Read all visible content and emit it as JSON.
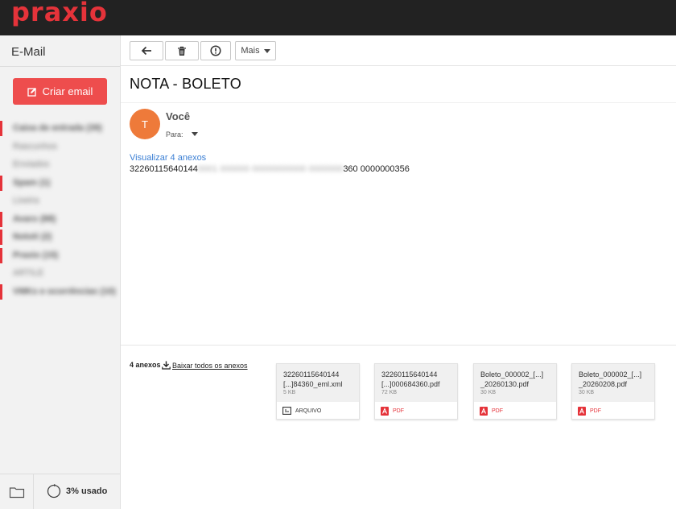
{
  "brand": {
    "logo_text": "praxio",
    "color": "#e5333a"
  },
  "sidebar": {
    "title": "E-Mail",
    "create_label": "Criar email",
    "folders": [
      {
        "label": "Caixa de entrada (39)",
        "marked": true,
        "bold": true
      },
      {
        "label": "Rascunhos",
        "marked": false,
        "bold": false
      },
      {
        "label": "Enviados",
        "marked": false,
        "bold": false
      },
      {
        "label": "Spam (1)",
        "marked": true,
        "bold": true
      },
      {
        "label": "Lixeira",
        "marked": false,
        "bold": false
      },
      {
        "label": "Avaro (88)",
        "marked": true,
        "bold": true
      },
      {
        "label": "Nototi (2)",
        "marked": true,
        "bold": true
      },
      {
        "label": "Praxio (15)",
        "marked": true,
        "bold": true
      },
      {
        "label": "ARTILE",
        "marked": false,
        "bold": false
      },
      {
        "label": "VMKs e ocorrências (10)",
        "marked": true,
        "bold": true
      }
    ],
    "usage": "3% usado"
  },
  "toolbar": {
    "more_label": "Mais"
  },
  "message": {
    "subject": "NOTA - BOLETO",
    "avatar_letter": "T",
    "sender": "Você",
    "to_label": "Para:",
    "view_attachments": "Visualizar 4 anexos",
    "body_start": "32260115640144",
    "body_redacted": "0001 000000 00000000000 0000000",
    "body_end": "360 0000000356"
  },
  "attachments": {
    "count_label": "4 anexos",
    "download_all": "Baixar todos os anexos",
    "items": [
      {
        "name_line1": "32260115640144",
        "name_line2": "[...]84360_eml.xml",
        "size": "5 KB",
        "type_label": "ARQUIVO",
        "type": "file"
      },
      {
        "name_line1": "32260115640144",
        "name_line2": "[...]000684360.pdf",
        "size": "72 KB",
        "type_label": "PDF",
        "type": "pdf"
      },
      {
        "name_line1": "Boleto_000002_[...]",
        "name_line2": "_20260130.pdf",
        "size": "30 KB",
        "type_label": "PDF",
        "type": "pdf"
      },
      {
        "name_line1": "Boleto_000002_[...]",
        "name_line2": "_20260208.pdf",
        "size": "30 KB",
        "type_label": "PDF",
        "type": "pdf"
      }
    ]
  }
}
